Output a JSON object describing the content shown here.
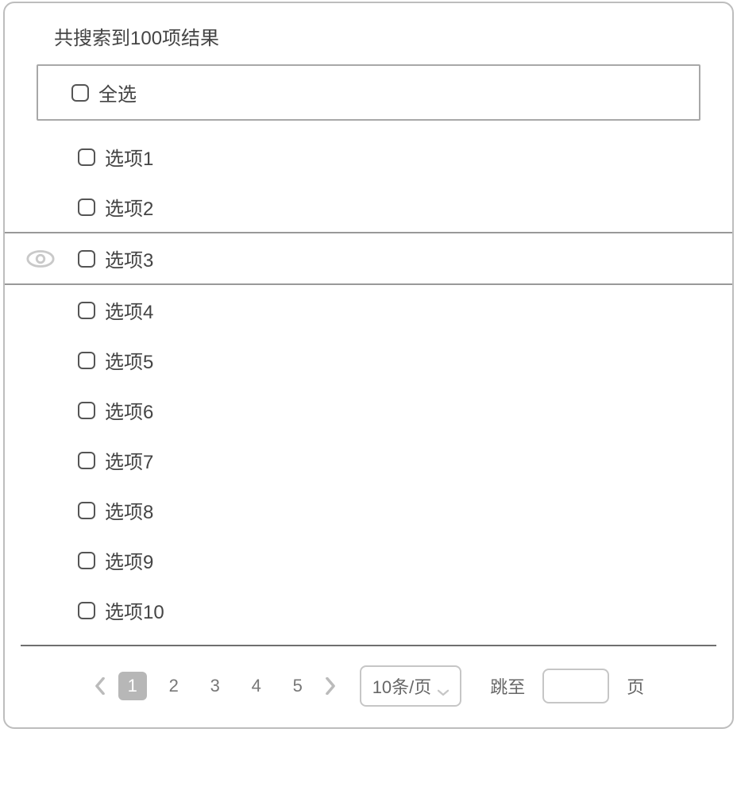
{
  "header": "共搜索到100项结果",
  "selectAll": "全选",
  "options": [
    {
      "label": "选项1",
      "highlight": false,
      "eye": false
    },
    {
      "label": "选项2",
      "highlight": false,
      "eye": false
    },
    {
      "label": "选项3",
      "highlight": true,
      "eye": true
    },
    {
      "label": "选项4",
      "highlight": false,
      "eye": false
    },
    {
      "label": "选项5",
      "highlight": false,
      "eye": false
    },
    {
      "label": "选项6",
      "highlight": false,
      "eye": false
    },
    {
      "label": "选项7",
      "highlight": false,
      "eye": false
    },
    {
      "label": "选项8",
      "highlight": false,
      "eye": false
    },
    {
      "label": "选项9",
      "highlight": false,
      "eye": false
    },
    {
      "label": "选项10",
      "highlight": false,
      "eye": false
    }
  ],
  "pagination": {
    "pages": [
      "1",
      "2",
      "3",
      "4",
      "5"
    ],
    "active": 0,
    "pageSize": "10条/页",
    "jumpLabel": "跳至",
    "jumpSuffix": "页",
    "jumpValue": ""
  }
}
